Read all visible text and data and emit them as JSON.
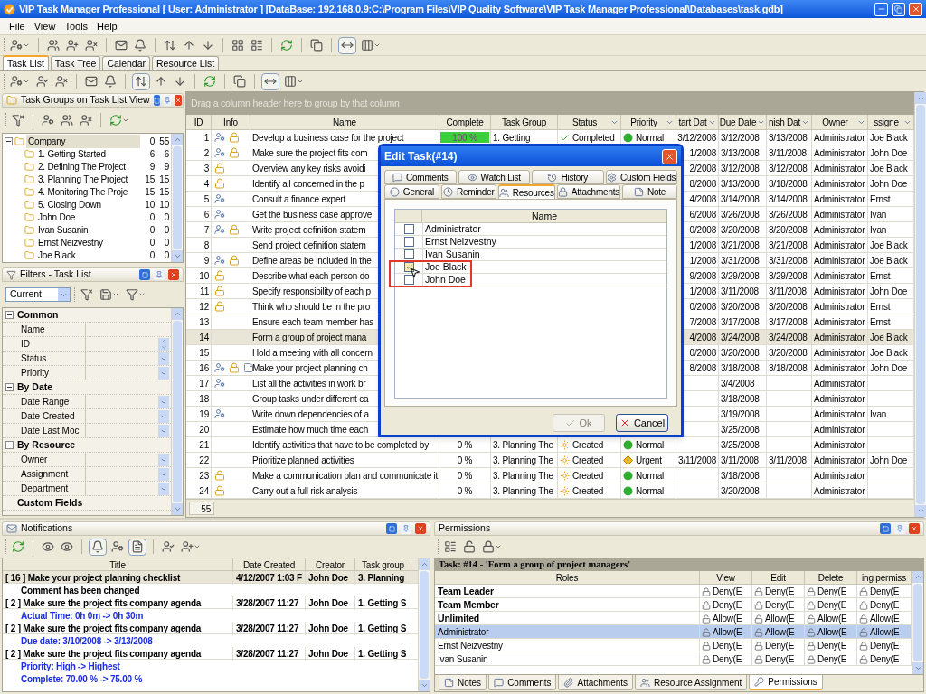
{
  "window": {
    "title": "VIP Task Manager Professional [ User: Administrator ] [DataBase: 192.168.0.9:C:\\Program Files\\VIP Quality Software\\VIP Task Manager Professional\\Databases\\task.gdb]"
  },
  "menu": [
    "File",
    "View",
    "Tools",
    "Help"
  ],
  "main_tabs": [
    {
      "label": "Task List",
      "selected": true
    },
    {
      "label": "Task Tree",
      "selected": false
    },
    {
      "label": "Calendar",
      "selected": false
    },
    {
      "label": "Resource List",
      "selected": false
    }
  ],
  "task_groups": {
    "title": "Task Groups on Task List View",
    "tree": [
      {
        "label": "Company",
        "value_1": "0",
        "value_2": "55",
        "expanded": true,
        "selected": true,
        "children": [
          {
            "label": "1. Getting Started",
            "value_1": "6",
            "value_2": "6",
            "selected": false
          },
          {
            "label": "2. Defining The Project",
            "value_1": "9",
            "value_2": "9",
            "selected": false
          },
          {
            "label": "3. Planning The Project",
            "value_1": "15",
            "value_2": "15",
            "selected": false
          },
          {
            "label": "4. Monitoring The Proje",
            "value_1": "15",
            "value_2": "15",
            "selected": false
          },
          {
            "label": "5. Closing Down",
            "value_1": "10",
            "value_2": "10",
            "selected": false
          },
          {
            "label": "John Doe",
            "value_1": "0",
            "value_2": "0",
            "selected": false
          },
          {
            "label": "Ivan Susanin",
            "value_1": "0",
            "value_2": "0",
            "selected": false
          },
          {
            "label": "Ernst Neizvestny",
            "value_1": "0",
            "value_2": "0",
            "selected": false
          },
          {
            "label": "Joe Black",
            "value_1": "0",
            "value_2": "0",
            "selected": false
          }
        ]
      }
    ]
  },
  "filters": {
    "title": "Filters - Task List",
    "preset": "Current",
    "categories": [
      {
        "label": "Common",
        "expanded": true,
        "fields": [
          {
            "label": "Name",
            "kind": "text"
          },
          {
            "label": "ID",
            "kind": "spin"
          },
          {
            "label": "Status",
            "kind": "dropdown"
          },
          {
            "label": "Priority",
            "kind": "dropdown"
          }
        ]
      },
      {
        "label": "By Date",
        "expanded": true,
        "fields": [
          {
            "label": "Date Range",
            "kind": "dropdown"
          },
          {
            "label": "Date Created",
            "kind": "dropdown"
          },
          {
            "label": "Date Last Moc",
            "kind": "dropdown"
          }
        ]
      },
      {
        "label": "By Resource",
        "expanded": true,
        "fields": [
          {
            "label": "Owner",
            "kind": "dropdown"
          },
          {
            "label": "Assignment",
            "kind": "dropdown"
          },
          {
            "label": "Department",
            "kind": "dropdown"
          }
        ]
      },
      {
        "label": "Custom Fields"
      }
    ]
  },
  "task_grid": {
    "group_hint": "Drag a column header here to group by that column",
    "row_count": "55",
    "columns": [
      {
        "label": "ID",
        "filter": false
      },
      {
        "label": "Info",
        "filter": false
      },
      {
        "label": "Name",
        "filter": false
      },
      {
        "label": "Complete",
        "filter": false
      },
      {
        "label": "Task Group",
        "filter": false
      },
      {
        "label": "Status",
        "filter": true
      },
      {
        "label": "Priority",
        "filter": true
      },
      {
        "label": "tart Dat",
        "filter": true
      },
      {
        "label": "Due Date",
        "filter": true
      },
      {
        "label": "nish Dat",
        "filter": true
      },
      {
        "label": "Owner",
        "filter": true
      },
      {
        "label": "ssigne",
        "filter": true
      }
    ],
    "rows": [
      {
        "id": "1",
        "info": [
          {
            "kind": "resource"
          },
          {
            "kind": "lock"
          }
        ],
        "name": "Develop a business case for the project",
        "complete": "100 %",
        "level": 1,
        "task_group": "1. Getting",
        "status": {
          "kind": "completed",
          "label": "Completed"
        },
        "priority": {
          "kind": "normal",
          "label": "Normal"
        },
        "start": "3/12/2008",
        "due": "3/12/2008",
        "finish": "3/13/2008",
        "owner": "Administrator",
        "assignee": "Joe Black",
        "selected": false
      },
      {
        "id": "2",
        "info": [
          {
            "kind": "resource"
          },
          {
            "kind": "lock"
          }
        ],
        "name": "Make sure the project fits com",
        "start": "1/2008",
        "due": "3/13/2008",
        "finish": "3/11/2008",
        "owner": "Administrator",
        "assignee": "John Doe",
        "selected": false
      },
      {
        "id": "3",
        "info": [
          {
            "kind": "lock"
          }
        ],
        "name": "Overview any key risks avoidi",
        "start": "2/2008",
        "due": "3/12/2008",
        "finish": "3/12/2008",
        "owner": "Administrator",
        "assignee": "Joe Black",
        "selected": false
      },
      {
        "id": "4",
        "info": [
          {
            "kind": "lock"
          }
        ],
        "name": "Identify all concerned in the p",
        "start": "8/2008",
        "due": "3/13/2008",
        "finish": "3/18/2008",
        "owner": "Administrator",
        "assignee": "John Doe",
        "selected": false
      },
      {
        "id": "5",
        "info": [
          {
            "kind": "resource"
          }
        ],
        "name": "Consult a finance expert",
        "start": "4/2008",
        "due": "3/14/2008",
        "finish": "3/14/2008",
        "owner": "Administrator",
        "assignee": "Ernst",
        "selected": false
      },
      {
        "id": "6",
        "info": [
          {
            "kind": "resource"
          }
        ],
        "name": "Get the business case approve",
        "start": "6/2008",
        "due": "3/26/2008",
        "finish": "3/26/2008",
        "owner": "Administrator",
        "assignee": "Ivan",
        "selected": false
      },
      {
        "id": "7",
        "info": [
          {
            "kind": "resource"
          },
          {
            "kind": "lock"
          }
        ],
        "name": "Write project definition statem",
        "start": "0/2008",
        "due": "3/20/2008",
        "finish": "3/20/2008",
        "owner": "Administrator",
        "assignee": "Ivan",
        "selected": false
      },
      {
        "id": "8",
        "name": "Send project definition statem",
        "start": "1/2008",
        "due": "3/21/2008",
        "finish": "3/21/2008",
        "owner": "Administrator",
        "assignee": "Joe Black",
        "selected": false
      },
      {
        "id": "9",
        "info": [
          {
            "kind": "resource"
          },
          {
            "kind": "lock"
          }
        ],
        "name": "Define areas be included in the",
        "start": "1/2008",
        "due": "3/31/2008",
        "finish": "3/31/2008",
        "owner": "Administrator",
        "assignee": "Joe Black",
        "selected": false
      },
      {
        "id": "10",
        "info": [
          {
            "kind": "lock"
          }
        ],
        "name": "Describe what each person do",
        "start": "9/2008",
        "due": "3/29/2008",
        "finish": "3/29/2008",
        "owner": "Administrator",
        "assignee": "Ernst",
        "selected": false
      },
      {
        "id": "11",
        "info": [
          {
            "kind": "lock"
          }
        ],
        "name": "Specify responsibility of each p",
        "start": "1/2008",
        "due": "3/11/2008",
        "finish": "3/11/2008",
        "owner": "Administrator",
        "assignee": "John Doe",
        "selected": false
      },
      {
        "id": "12",
        "info": [
          {
            "kind": "lock"
          }
        ],
        "name": "Think who should be in the pro",
        "start": "0/2008",
        "due": "3/20/2008",
        "finish": "3/20/2008",
        "owner": "Administrator",
        "assignee": "Ernst",
        "selected": false
      },
      {
        "id": "13",
        "name": "Ensure each team member has",
        "start": "7/2008",
        "due": "3/17/2008",
        "finish": "3/17/2008",
        "owner": "Administrator",
        "assignee": "Ernst",
        "selected": false
      },
      {
        "id": "14",
        "name": "Form a group of project mana",
        "start": "4/2008",
        "due": "3/24/2008",
        "finish": "3/24/2008",
        "owner": "Administrator",
        "assignee": "Joe Black",
        "selected": true
      },
      {
        "id": "15",
        "name": "Hold a meeting with all concern",
        "start": "0/2008",
        "due": "3/20/2008",
        "finish": "3/20/2008",
        "owner": "Administrator",
        "assignee": "Joe Black",
        "selected": false
      },
      {
        "id": "16",
        "info": [
          {
            "kind": "resource"
          },
          {
            "kind": "lock"
          },
          {
            "kind": "note"
          }
        ],
        "name": "Make your project planning ch",
        "start": "8/2008",
        "due": "3/18/2008",
        "finish": "3/18/2008",
        "owner": "Administrator",
        "assignee": "John Doe",
        "selected": false
      },
      {
        "id": "17",
        "info": [
          {
            "kind": "resource"
          }
        ],
        "name": "List all the activities in work br",
        "due": "3/4/2008",
        "owner": "Administrator",
        "selected": false
      },
      {
        "id": "18",
        "name": "Group tasks under different ca",
        "due": "3/18/2008",
        "owner": "Administrator",
        "selected": false
      },
      {
        "id": "19",
        "info": [
          {
            "kind": "resource"
          }
        ],
        "name": "Write down dependencies of a",
        "due": "3/19/2008",
        "owner": "Administrator",
        "assignee": "Ivan",
        "selected": false
      },
      {
        "id": "20",
        "name": "Estimate how much time each",
        "due": "3/25/2008",
        "owner": "Administrator",
        "selected": false
      },
      {
        "id": "21",
        "name": "Identify activities that have to be completed by",
        "complete": "0 %",
        "level": 0,
        "task_group": "3. Planning The",
        "status": {
          "kind": "created",
          "label": "Created"
        },
        "priority": {
          "kind": "normal",
          "label": "Normal"
        },
        "due": "3/25/2008",
        "owner": "Administrator",
        "selected": false
      },
      {
        "id": "22",
        "name": "Prioritize planned activities",
        "complete": "0 %",
        "level": 0,
        "task_group": "3. Planning The",
        "status": {
          "kind": "created",
          "label": "Created"
        },
        "priority": {
          "kind": "urgent",
          "label": "Urgent"
        },
        "start": "3/11/2008",
        "due": "3/11/2008",
        "finish": "3/11/2008",
        "owner": "Administrator",
        "assignee": "John Doe",
        "selected": false
      },
      {
        "id": "23",
        "info": [
          {
            "kind": "lock"
          }
        ],
        "name": "Make a communication plan and communicate it",
        "complete": "0 %",
        "level": 0,
        "task_group": "3. Planning The",
        "status": {
          "kind": "created",
          "label": "Created"
        },
        "priority": {
          "kind": "normal",
          "label": "Normal"
        },
        "due": "3/18/2008",
        "owner": "Administrator",
        "selected": false
      },
      {
        "id": "24",
        "info": [
          {
            "kind": "lock"
          }
        ],
        "name": "Carry out a full risk analysis",
        "complete": "0 %",
        "level": 0,
        "task_group": "3. Planning The",
        "status": {
          "kind": "created",
          "label": "Created"
        },
        "priority": {
          "kind": "normal",
          "label": "Normal"
        },
        "due": "3/20/2008",
        "owner": "Administrator",
        "selected": false
      }
    ]
  },
  "dialog": {
    "title": "Edit Task(#14)",
    "tab_rows": [
      [
        {
          "label": "Comments",
          "selected": false
        },
        {
          "label": "Watch List",
          "selected": false
        },
        {
          "label": "History",
          "selected": false
        },
        {
          "label": "Custom Fields",
          "selected": false
        }
      ],
      [
        {
          "label": "General",
          "selected": false
        },
        {
          "label": "Reminder",
          "selected": false
        },
        {
          "label": "Resources",
          "selected": true
        },
        {
          "label": "Attachments",
          "selected": false
        },
        {
          "label": "Note",
          "selected": false
        }
      ]
    ],
    "resource_header": "Name",
    "resources": [
      {
        "name": "Administrator",
        "checked": false
      },
      {
        "name": "Ernst Neizvestny",
        "checked": false
      },
      {
        "name": "Ivan Susanin",
        "checked": false
      },
      {
        "name": "Joe Black",
        "checked": true
      },
      {
        "name": "John Doe",
        "checked": false
      }
    ],
    "buttons": [
      {
        "label": "Ok",
        "kind": "ok",
        "disabled": true
      },
      {
        "label": "Cancel",
        "kind": "cancel",
        "disabled": false
      }
    ]
  },
  "notifications": {
    "title": "Notifications",
    "columns": [
      "Title",
      "Date Created",
      "Creator",
      "Task group"
    ],
    "entries": [
      {
        "title": "[ 16 ] Make your project planning checklist",
        "date": "4/12/2007 1:03 F",
        "creator": "John Doe",
        "task_group": "3. Planning",
        "selected": true,
        "details": [
          {
            "kind": "comment",
            "text": "Comment has been changed"
          }
        ]
      },
      {
        "title": "[ 2 ] Make sure the project fits company agenda",
        "date": "3/28/2007 11:27",
        "creator": "John Doe",
        "task_group": "1. Getting S",
        "selected": false,
        "details": [
          {
            "kind": "change",
            "text": "Actual Time: 0h 0m -> 0h 30m"
          }
        ]
      },
      {
        "title": "[ 2 ] Make sure the project fits company agenda",
        "date": "3/28/2007 11:27",
        "creator": "John Doe",
        "task_group": "1. Getting S",
        "selected": false,
        "details": [
          {
            "kind": "change",
            "text": "Due date: 3/10/2008 -> 3/13/2008"
          }
        ]
      },
      {
        "title": "[ 2 ] Make sure the project fits company agenda",
        "date": "3/28/2007 11:27",
        "creator": "John Doe",
        "task_group": "1. Getting S",
        "selected": false,
        "details": [
          {
            "kind": "change",
            "text": "Priority: High -> Highest"
          },
          {
            "kind": "change",
            "text": "Complete: 70.00 % -> 75.00 %"
          }
        ]
      }
    ]
  },
  "permissions": {
    "title": "Permissions",
    "task": "Task: #14 - 'Form a group of project managers'",
    "columns": [
      "Roles",
      "View",
      "Edit",
      "Delete",
      "ing permiss"
    ],
    "rows": [
      {
        "kind": "role",
        "selected": false,
        "cells": [
          {
            "text": "Team Leader"
          },
          {
            "text": "Deny(E",
            "allowed": false
          },
          {
            "text": "Deny(E",
            "allowed": false
          },
          {
            "text": "Deny(E",
            "allowed": false
          },
          {
            "text": "Deny(E",
            "allowed": false
          }
        ]
      },
      {
        "kind": "role",
        "selected": false,
        "cells": [
          {
            "text": "Team Member"
          },
          {
            "text": "Deny(E",
            "allowed": false
          },
          {
            "text": "Deny(E",
            "allowed": false
          },
          {
            "text": "Deny(E",
            "allowed": false
          },
          {
            "text": "Deny(E",
            "allowed": false
          }
        ]
      },
      {
        "kind": "role",
        "selected": false,
        "cells": [
          {
            "text": "Unlimited"
          },
          {
            "text": "Allow(E",
            "allowed": true
          },
          {
            "text": "Allow(E",
            "allowed": true
          },
          {
            "text": "Allow(E",
            "allowed": true
          },
          {
            "text": "Allow(E",
            "allowed": true
          }
        ]
      },
      {
        "kind": "user",
        "selected": true,
        "cells": [
          {
            "text": "Administrator"
          },
          {
            "text": "Allow(E",
            "allowed": true
          },
          {
            "text": "Allow(E",
            "allowed": true
          },
          {
            "text": "Allow(E",
            "allowed": true
          },
          {
            "text": "Allow(E",
            "allowed": true
          }
        ]
      },
      {
        "kind": "user",
        "selected": false,
        "cells": [
          {
            "text": "Ernst Neizvestny"
          },
          {
            "text": "Deny(E",
            "allowed": false
          },
          {
            "text": "Deny(E",
            "allowed": false
          },
          {
            "text": "Deny(E",
            "allowed": false
          },
          {
            "text": "Deny(E",
            "allowed": false
          }
        ]
      },
      {
        "kind": "user",
        "selected": false,
        "cells": [
          {
            "text": "Ivan Susanin"
          },
          {
            "text": "Deny(E",
            "allowed": false
          },
          {
            "text": "Deny(E",
            "allowed": false
          },
          {
            "text": "Deny(E",
            "allowed": false
          },
          {
            "text": "Deny(E",
            "allowed": false
          }
        ]
      }
    ],
    "tabs": [
      {
        "label": "Notes",
        "selected": false
      },
      {
        "label": "Comments",
        "selected": false
      },
      {
        "label": "Attachments",
        "selected": false
      },
      {
        "label": "Resource Assignment",
        "selected": false
      },
      {
        "label": "Permissions",
        "selected": true
      }
    ]
  }
}
